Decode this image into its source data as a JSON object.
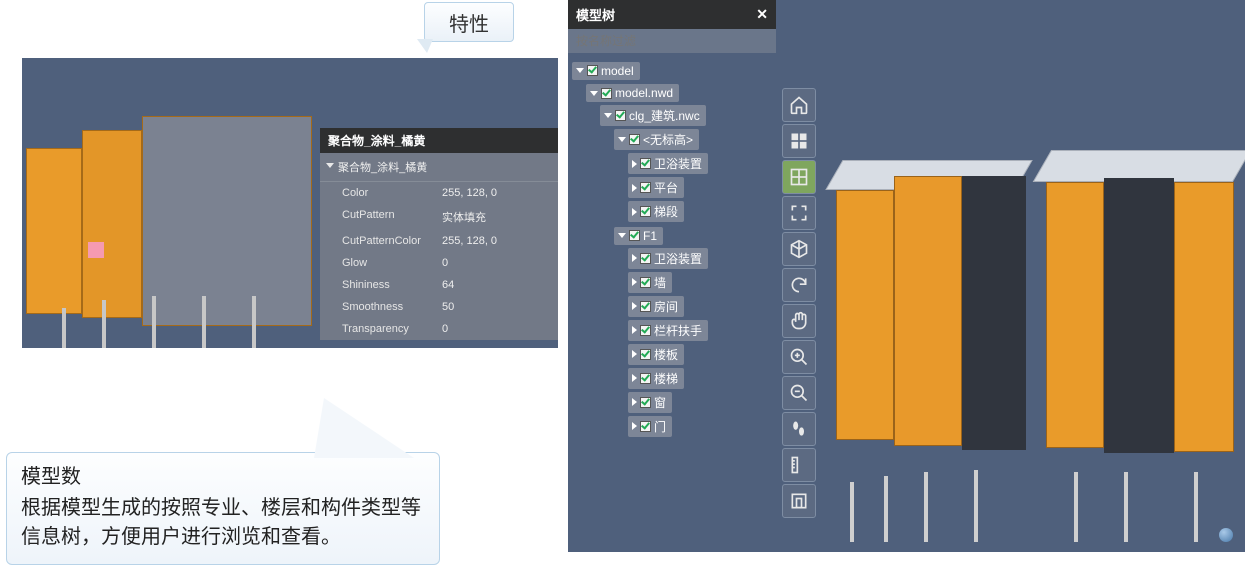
{
  "callout_top": "特性",
  "properties_panel": {
    "title": "聚合物_涂料_橘黄",
    "item_name": "聚合物_涂料_橘黄",
    "rows": [
      {
        "key": "Color",
        "val": "255, 128, 0"
      },
      {
        "key": "CutPattern",
        "val": "实体填充"
      },
      {
        "key": "CutPatternColor",
        "val": "255, 128, 0"
      },
      {
        "key": "Glow",
        "val": "0"
      },
      {
        "key": "Shininess",
        "val": "64"
      },
      {
        "key": "Smoothness",
        "val": "50"
      },
      {
        "key": "Transparency",
        "val": "0"
      }
    ]
  },
  "callout_bottom": {
    "title": "模型数",
    "body": "根据模型生成的按照专业、楼层和构件类型等信息树，方便用户进行浏览和查看。"
  },
  "tree_panel": {
    "title": "模型树",
    "search_placeholder": "按名称过滤",
    "nodes": [
      {
        "label": "model",
        "indent": 0,
        "expanded": true
      },
      {
        "label": "model.nwd",
        "indent": 1,
        "expanded": true
      },
      {
        "label": "clg_建筑.nwc",
        "indent": 2,
        "expanded": true
      },
      {
        "label": "<无标高>",
        "indent": 3,
        "expanded": true
      },
      {
        "label": "卫浴装置",
        "indent": 4,
        "expanded": false
      },
      {
        "label": "平台",
        "indent": 4,
        "expanded": false
      },
      {
        "label": "梯段",
        "indent": 4,
        "expanded": false
      },
      {
        "label": "F1",
        "indent": 3,
        "expanded": true
      },
      {
        "label": "卫浴装置",
        "indent": 4,
        "expanded": false
      },
      {
        "label": "墙",
        "indent": 4,
        "expanded": false
      },
      {
        "label": "房间",
        "indent": 4,
        "expanded": false
      },
      {
        "label": "栏杆扶手",
        "indent": 4,
        "expanded": false
      },
      {
        "label": "楼板",
        "indent": 4,
        "expanded": false
      },
      {
        "label": "楼梯",
        "indent": 4,
        "expanded": false
      },
      {
        "label": "窗",
        "indent": 4,
        "expanded": false
      },
      {
        "label": "门",
        "indent": 4,
        "expanded": false
      }
    ]
  },
  "toolbar": {
    "items": [
      {
        "name": "home-icon"
      },
      {
        "name": "windows-icon"
      },
      {
        "name": "grid-icon",
        "active": true
      },
      {
        "name": "fullscreen-icon"
      },
      {
        "name": "cube-icon"
      },
      {
        "name": "refresh-icon"
      },
      {
        "name": "pan-icon"
      },
      {
        "name": "zoom-in-icon"
      },
      {
        "name": "zoom-out-icon"
      },
      {
        "name": "walk-icon"
      },
      {
        "name": "ruler-icon"
      },
      {
        "name": "section-icon"
      }
    ]
  }
}
